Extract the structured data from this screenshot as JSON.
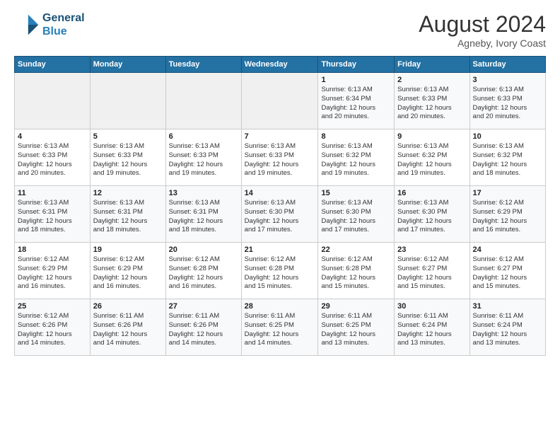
{
  "header": {
    "logo_line1": "General",
    "logo_line2": "Blue",
    "title": "August 2024",
    "subtitle": "Agneby, Ivory Coast"
  },
  "days_of_week": [
    "Sunday",
    "Monday",
    "Tuesday",
    "Wednesday",
    "Thursday",
    "Friday",
    "Saturday"
  ],
  "weeks": [
    [
      {
        "day": "",
        "info": ""
      },
      {
        "day": "",
        "info": ""
      },
      {
        "day": "",
        "info": ""
      },
      {
        "day": "",
        "info": ""
      },
      {
        "day": "1",
        "info": "Sunrise: 6:13 AM\nSunset: 6:34 PM\nDaylight: 12 hours\nand 20 minutes."
      },
      {
        "day": "2",
        "info": "Sunrise: 6:13 AM\nSunset: 6:33 PM\nDaylight: 12 hours\nand 20 minutes."
      },
      {
        "day": "3",
        "info": "Sunrise: 6:13 AM\nSunset: 6:33 PM\nDaylight: 12 hours\nand 20 minutes."
      }
    ],
    [
      {
        "day": "4",
        "info": "Sunrise: 6:13 AM\nSunset: 6:33 PM\nDaylight: 12 hours\nand 20 minutes."
      },
      {
        "day": "5",
        "info": "Sunrise: 6:13 AM\nSunset: 6:33 PM\nDaylight: 12 hours\nand 19 minutes."
      },
      {
        "day": "6",
        "info": "Sunrise: 6:13 AM\nSunset: 6:33 PM\nDaylight: 12 hours\nand 19 minutes."
      },
      {
        "day": "7",
        "info": "Sunrise: 6:13 AM\nSunset: 6:33 PM\nDaylight: 12 hours\nand 19 minutes."
      },
      {
        "day": "8",
        "info": "Sunrise: 6:13 AM\nSunset: 6:32 PM\nDaylight: 12 hours\nand 19 minutes."
      },
      {
        "day": "9",
        "info": "Sunrise: 6:13 AM\nSunset: 6:32 PM\nDaylight: 12 hours\nand 19 minutes."
      },
      {
        "day": "10",
        "info": "Sunrise: 6:13 AM\nSunset: 6:32 PM\nDaylight: 12 hours\nand 18 minutes."
      }
    ],
    [
      {
        "day": "11",
        "info": "Sunrise: 6:13 AM\nSunset: 6:31 PM\nDaylight: 12 hours\nand 18 minutes."
      },
      {
        "day": "12",
        "info": "Sunrise: 6:13 AM\nSunset: 6:31 PM\nDaylight: 12 hours\nand 18 minutes."
      },
      {
        "day": "13",
        "info": "Sunrise: 6:13 AM\nSunset: 6:31 PM\nDaylight: 12 hours\nand 18 minutes."
      },
      {
        "day": "14",
        "info": "Sunrise: 6:13 AM\nSunset: 6:30 PM\nDaylight: 12 hours\nand 17 minutes."
      },
      {
        "day": "15",
        "info": "Sunrise: 6:13 AM\nSunset: 6:30 PM\nDaylight: 12 hours\nand 17 minutes."
      },
      {
        "day": "16",
        "info": "Sunrise: 6:13 AM\nSunset: 6:30 PM\nDaylight: 12 hours\nand 17 minutes."
      },
      {
        "day": "17",
        "info": "Sunrise: 6:12 AM\nSunset: 6:29 PM\nDaylight: 12 hours\nand 16 minutes."
      }
    ],
    [
      {
        "day": "18",
        "info": "Sunrise: 6:12 AM\nSunset: 6:29 PM\nDaylight: 12 hours\nand 16 minutes."
      },
      {
        "day": "19",
        "info": "Sunrise: 6:12 AM\nSunset: 6:29 PM\nDaylight: 12 hours\nand 16 minutes."
      },
      {
        "day": "20",
        "info": "Sunrise: 6:12 AM\nSunset: 6:28 PM\nDaylight: 12 hours\nand 16 minutes."
      },
      {
        "day": "21",
        "info": "Sunrise: 6:12 AM\nSunset: 6:28 PM\nDaylight: 12 hours\nand 15 minutes."
      },
      {
        "day": "22",
        "info": "Sunrise: 6:12 AM\nSunset: 6:28 PM\nDaylight: 12 hours\nand 15 minutes."
      },
      {
        "day": "23",
        "info": "Sunrise: 6:12 AM\nSunset: 6:27 PM\nDaylight: 12 hours\nand 15 minutes."
      },
      {
        "day": "24",
        "info": "Sunrise: 6:12 AM\nSunset: 6:27 PM\nDaylight: 12 hours\nand 15 minutes."
      }
    ],
    [
      {
        "day": "25",
        "info": "Sunrise: 6:12 AM\nSunset: 6:26 PM\nDaylight: 12 hours\nand 14 minutes."
      },
      {
        "day": "26",
        "info": "Sunrise: 6:11 AM\nSunset: 6:26 PM\nDaylight: 12 hours\nand 14 minutes."
      },
      {
        "day": "27",
        "info": "Sunrise: 6:11 AM\nSunset: 6:26 PM\nDaylight: 12 hours\nand 14 minutes."
      },
      {
        "day": "28",
        "info": "Sunrise: 6:11 AM\nSunset: 6:25 PM\nDaylight: 12 hours\nand 14 minutes."
      },
      {
        "day": "29",
        "info": "Sunrise: 6:11 AM\nSunset: 6:25 PM\nDaylight: 12 hours\nand 13 minutes."
      },
      {
        "day": "30",
        "info": "Sunrise: 6:11 AM\nSunset: 6:24 PM\nDaylight: 12 hours\nand 13 minutes."
      },
      {
        "day": "31",
        "info": "Sunrise: 6:11 AM\nSunset: 6:24 PM\nDaylight: 12 hours\nand 13 minutes."
      }
    ]
  ]
}
